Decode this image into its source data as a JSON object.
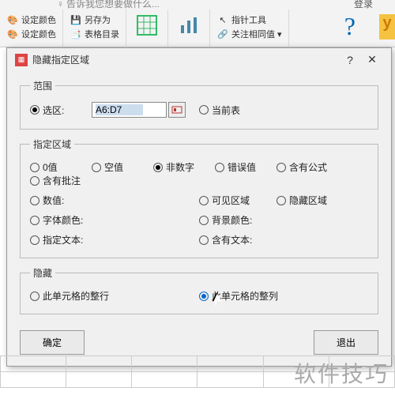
{
  "app": {
    "tellme": "告诉我您想要做什么...",
    "login": "登录"
  },
  "ribbon": {
    "setcolor1": "设定颜色",
    "setcolor2": "设定颜色",
    "saveas": "另存为",
    "tablecatalog": "表格目录",
    "pointer": "指针工具",
    "related": "关注相同值"
  },
  "dialog": {
    "title": "隐藏指定区域",
    "help": "?",
    "close": "✕",
    "range_legend": "范围",
    "selection": "选区:",
    "ref_value": "A6:D7",
    "current_sheet": "当前表",
    "area_legend": "指定区域",
    "opts": {
      "zero": "0值",
      "blank": "空值",
      "nonnum": "非数字",
      "error": "错误值",
      "hasformula": "含有公式",
      "hascomment": "含有批注",
      "numval": "数值:",
      "visible": "可见区域",
      "hidden": "隐藏区域",
      "fontcolor": "字体颜色:",
      "bgcolor": "背景颜色:",
      "spectext": "指定文本:",
      "hastext": "含有文本:"
    },
    "hide_legend": "隐藏",
    "hide_row": "此单元格的整行",
    "hide_col": "此单元格的整列",
    "ok": "确定",
    "exit": "退出"
  },
  "watermark": "软件技巧"
}
